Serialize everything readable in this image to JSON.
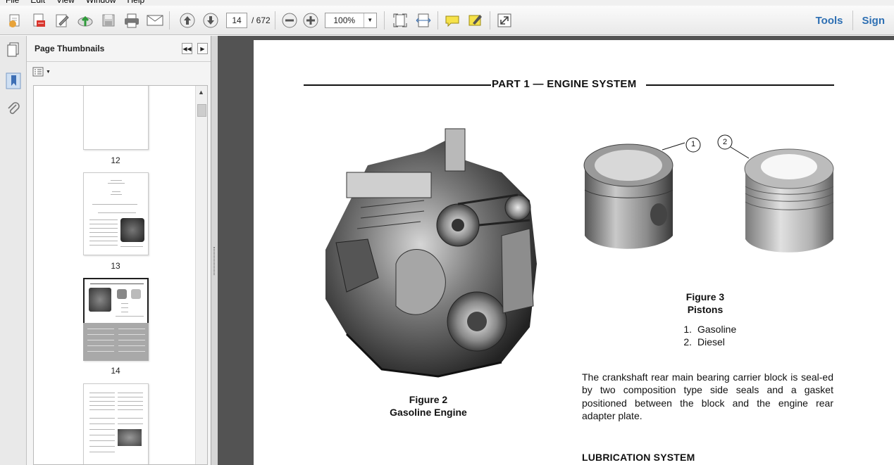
{
  "menu": [
    "File",
    "Edit",
    "View",
    "Window",
    "Help"
  ],
  "toolbar": {
    "icons": [
      "create-icon",
      "export-icon",
      "edit-icon",
      "upload-icon",
      "save-icon",
      "print-icon",
      "email-icon",
      "prev-page-icon",
      "next-page-icon",
      "zoom-out-icon",
      "zoom-in-icon",
      "fit-page-icon",
      "fit-width-icon",
      "comment-icon",
      "highlight-icon",
      "fullscreen-icon"
    ],
    "current_page": "14",
    "total_pages": "/ 672",
    "zoom": "100%",
    "tools_label": "Tools",
    "sign_label": "Sign"
  },
  "panel": {
    "title": "Page Thumbnails",
    "thumbnails": [
      {
        "label": "12"
      },
      {
        "label": "13"
      },
      {
        "label": "14",
        "selected": true
      },
      {
        "label": ""
      }
    ]
  },
  "document": {
    "header": "PART 1 — ENGINE SYSTEM",
    "figure2_title": "Figure 2",
    "figure2_caption": "Gasoline Engine",
    "figure3_title": "Figure 3",
    "figure3_caption": "Pistons",
    "callout1": "1",
    "callout2": "2",
    "pistons": [
      {
        "num": "1.",
        "name": "Gasoline"
      },
      {
        "num": "2.",
        "name": "Diesel"
      }
    ],
    "paragraph": "The crankshaft rear main bearing carrier block is seal-ed by two composition type side seals and a gasket positioned between the block and the engine rear adapter plate.",
    "section_heading": "LUBRICATION SYSTEM"
  }
}
